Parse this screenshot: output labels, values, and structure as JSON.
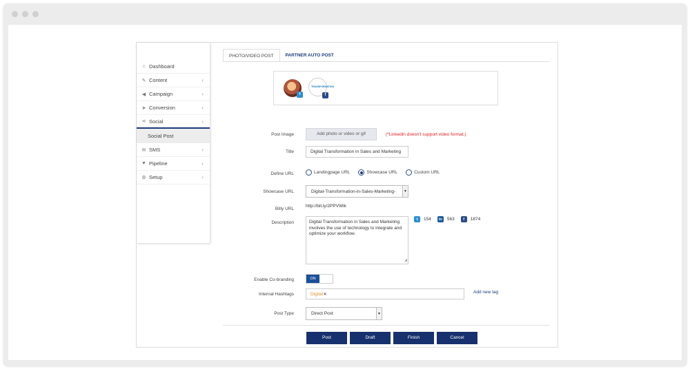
{
  "sidebar": {
    "items": [
      {
        "label": "Dashboard",
        "icon": "home-icon"
      },
      {
        "label": "Content",
        "icon": "edit-icon"
      },
      {
        "label": "Campaign",
        "icon": "megaphone-icon"
      },
      {
        "label": "Conversion",
        "icon": "cursor-icon"
      },
      {
        "label": "Social",
        "icon": "share-icon"
      },
      {
        "label": "SMS",
        "icon": "envelope-icon"
      },
      {
        "label": "Pipeline",
        "icon": "funnel-icon"
      },
      {
        "label": "Setup",
        "icon": "gear-icon"
      }
    ],
    "sub_item": "Social Post"
  },
  "tabs": {
    "photo_video": "PHOTO/VIDEO POST",
    "partner_auto": "PARTNER AUTO POST"
  },
  "profiles": {
    "logo_text": "TRANSFORMATION",
    "badge_tw": "t",
    "badge_fb": "f"
  },
  "form": {
    "post_image_label": "Post Image",
    "upload_button": "Add photo or video or gif",
    "linkedin_warning": "(*Linkedin doesn't support video format.)",
    "title_label": "Title",
    "title_value": "Digital Transformation in Sales and Marketing",
    "define_url_label": "Define URL",
    "url_options": [
      "Landingpage URL",
      "Showcase URL",
      "Custom URL"
    ],
    "url_selected": "Showcase URL",
    "showcase_url_label": "Showcase URL",
    "showcase_url_value": "Digital-Transformation-in-Sales-Marketing-",
    "bitly_label": "Bitly URL",
    "bitly_value": "http://bit.ly/2PPVWlk",
    "description_label": "Description",
    "description_value": "Digital Transformation in Sales and Marketing involves the use of technology to integrate and optimize your workflow.",
    "cobranding_label": "Enable Co-branding",
    "cobranding_state": "ON",
    "hashtags_label": "Internal Hashtags",
    "hashtag": "Digital",
    "add_tag": "Add new tag",
    "post_type_label": "Post Type",
    "post_type_value": "Direct Post"
  },
  "char_counts": {
    "twitter": "154",
    "linkedin": "563",
    "facebook": "1874"
  },
  "actions": {
    "post": "Post",
    "draft": "Draft",
    "finish": "Finish",
    "cancel": "Cancel"
  },
  "colors": {
    "primary": "#17316e",
    "warning": "#e02020",
    "tag": "#e0902c",
    "twitter": "#2b8fd6",
    "linkedin": "#1a5a9a",
    "facebook": "#2b4a8b"
  }
}
